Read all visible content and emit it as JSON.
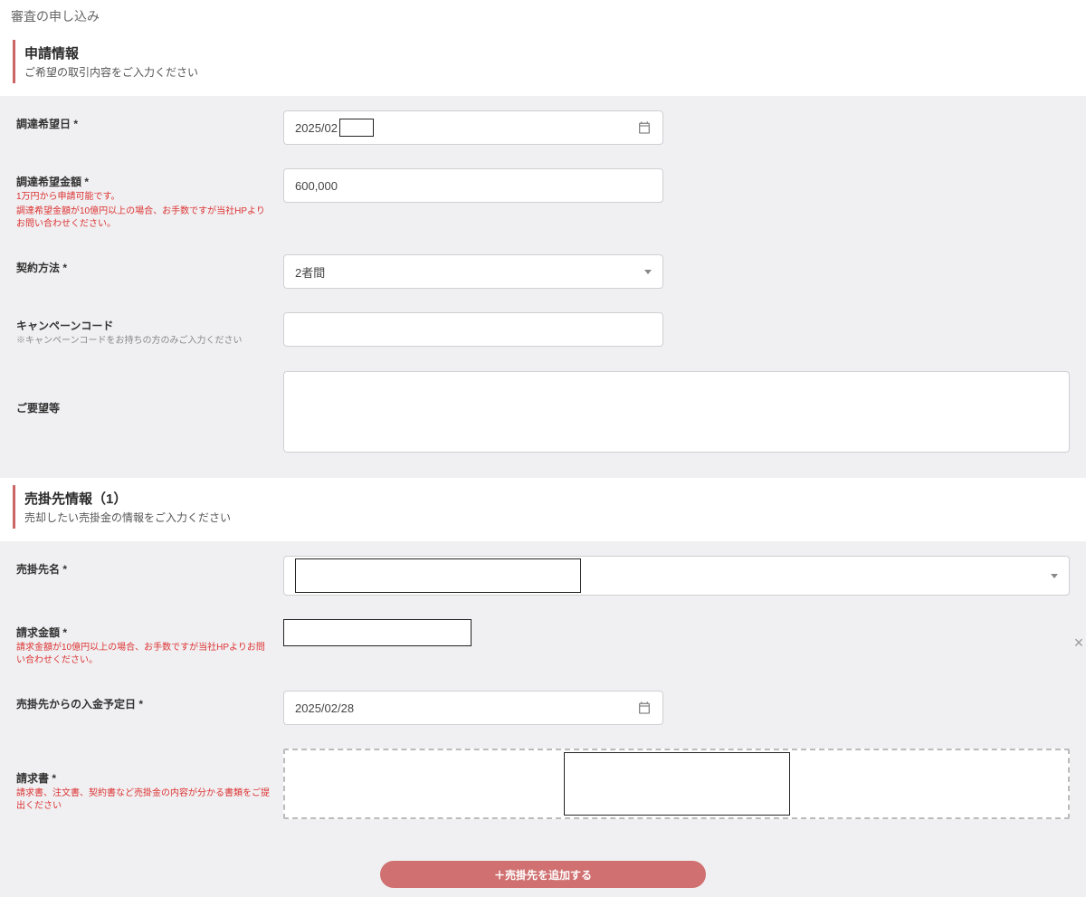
{
  "page": {
    "title": "審査の申し込み"
  },
  "section1": {
    "title": "申請情報",
    "subtitle": "ご希望の取引内容をご入力ください",
    "rows": {
      "desired_date": {
        "label": "調達希望日 *",
        "value_prefix": "2025/02"
      },
      "desired_amount": {
        "label": "調達希望金額 *",
        "hint1": "1万円から申請可能です。",
        "hint2": "調達希望金額が10億円以上の場合、お手数ですが当社HPよりお問い合わせください。",
        "value": "600,000"
      },
      "contract_method": {
        "label": "契約方法 *",
        "value": "2者間"
      },
      "campaign_code": {
        "label": "キャンペーンコード",
        "hint": "※キャンペーンコードをお持ちの方のみご入力ください",
        "value": ""
      },
      "requests": {
        "label": "ご要望等",
        "value": ""
      }
    }
  },
  "section2": {
    "title": "売掛先情報（1）",
    "subtitle": "売却したい売掛金の情報をご入力ください",
    "rows": {
      "client_name": {
        "label": "売掛先名 *",
        "value": ""
      },
      "billing_amount": {
        "label": "請求金額 *",
        "hint": "請求金額が10億円以上の場合、お手数ですが当社HPよりお問い合わせください。",
        "value": ""
      },
      "payment_date": {
        "label": "売掛先からの入金予定日 *",
        "value": "2025/02/28"
      },
      "invoice": {
        "label": "請求書 *",
        "hint": "請求書、注文書、契約書など売掛金の内容が分かる書類をご提出ください"
      }
    },
    "add_button": "＋売掛先を追加する",
    "close_label": "×"
  }
}
